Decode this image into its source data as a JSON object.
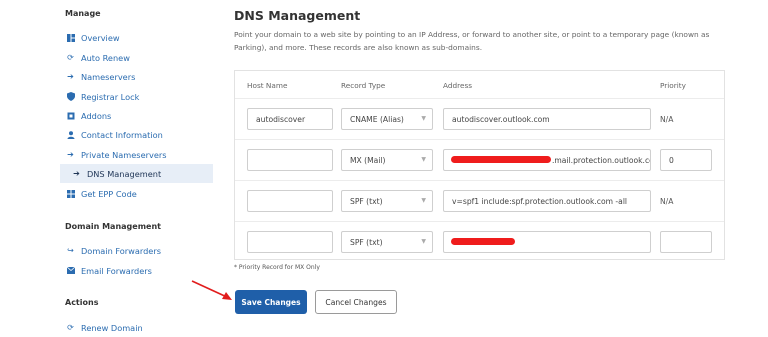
{
  "sidebar": {
    "manage_title": "Manage",
    "items": [
      {
        "label": "Overview",
        "icon": "dashboard-icon"
      },
      {
        "label": "Auto Renew",
        "icon": "refresh-icon"
      },
      {
        "label": "Nameservers",
        "icon": "arrow-right-icon"
      },
      {
        "label": "Registrar Lock",
        "icon": "shield-icon"
      },
      {
        "label": "Addons",
        "icon": "cube-icon"
      },
      {
        "label": "Contact Information",
        "icon": "user-icon"
      },
      {
        "label": "Private Nameservers",
        "icon": "arrow-right-icon"
      },
      {
        "label": "DNS Management",
        "icon": "arrow-right-icon",
        "active": true
      },
      {
        "label": "Get EPP Code",
        "icon": "grid-icon"
      }
    ],
    "domain_mgmt_title": "Domain Management",
    "domain_items": [
      {
        "label": "Domain Forwarders",
        "icon": "share-icon"
      },
      {
        "label": "Email Forwarders",
        "icon": "envelope-icon"
      }
    ],
    "actions_title": "Actions",
    "action_items": [
      {
        "label": "Renew Domain",
        "icon": "refresh-icon"
      }
    ]
  },
  "main": {
    "title": "DNS Management",
    "description": "Point your domain to a web site by pointing to an IP Address, or forward to another site, or point to a temporary page (known as Parking), and more. These records are also known as sub-domains.",
    "columns": [
      "Host Name",
      "Record Type",
      "Address",
      "Priority"
    ],
    "rows": [
      {
        "host": "autodiscover",
        "type": "CNAME (Alias)",
        "address": "autodiscover.outlook.com",
        "priority": "N/A"
      },
      {
        "host": "",
        "type": "MX (Mail)",
        "address": ".mail.protection.outlook.cc",
        "priority": "0"
      },
      {
        "host": "",
        "type": "SPF (txt)",
        "address": "v=spf1 include:spf.protection.outlook.com -all",
        "priority": "N/A"
      },
      {
        "host": "",
        "type": "SPF (txt)",
        "address": "",
        "priority": ""
      }
    ],
    "note": "* Priority Record for MX Only",
    "save_label": "Save Changes",
    "cancel_label": "Cancel Changes"
  },
  "colors": {
    "accent": "#1f5fa9",
    "link": "#2b6cb0",
    "redaction": "#ef1c1c",
    "arrow": "#e11d1d"
  }
}
